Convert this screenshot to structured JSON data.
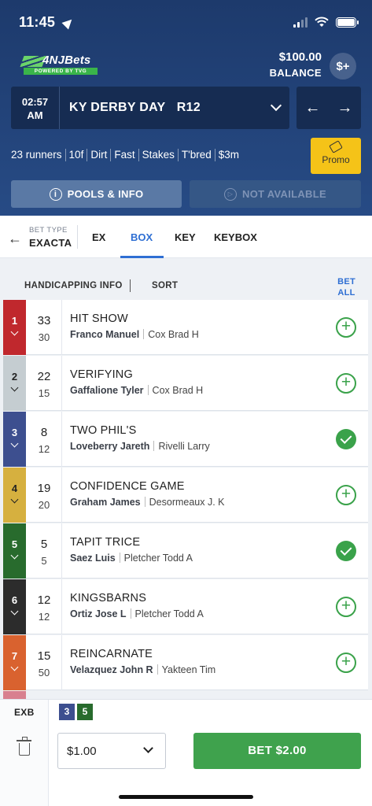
{
  "status_bar": {
    "time": "11:45"
  },
  "brand": {
    "logo_text": "4NJBets",
    "logo_subtitle": "POWERED BY TVG"
  },
  "account": {
    "balance_amount": "$100.00",
    "balance_label": "BALANCE",
    "deposit_icon": "dollar-plus-icon",
    "deposit_label": "$+"
  },
  "race": {
    "post_time": "02:57",
    "post_ampm": "AM",
    "title": "KY DERBY DAY",
    "race_number": "R12",
    "info": [
      "23 runners",
      "10f",
      "Dirt",
      "Fast",
      "Stakes",
      "T'bred",
      "$3m"
    ],
    "prev_arrow": "←",
    "next_arrow": "→"
  },
  "promo": {
    "label": "Promo"
  },
  "buttons": {
    "pools_info": "POOLS & INFO",
    "pools_info_icon": "i",
    "not_available": "NOT AVAILABLE",
    "not_available_icon": "▷"
  },
  "bet_type": {
    "back_arrow": "←",
    "label": "BET TYPE",
    "value": "EXACTA",
    "tabs": [
      {
        "label": "EX",
        "active": false
      },
      {
        "label": "BOX",
        "active": true
      },
      {
        "label": "KEY",
        "active": false
      },
      {
        "label": "KEYBOX",
        "active": false
      }
    ],
    "accent_color": "#2f6fd3"
  },
  "list_header": {
    "handicapping": "HANDICAPPING INFO",
    "sort": "SORT",
    "bet_all_line1": "BET",
    "bet_all_line2": "ALL"
  },
  "runners": [
    {
      "number": "1",
      "saddle_color": "#c0282d",
      "ml_odds": "33",
      "odds": "30",
      "name": "HIT SHOW",
      "jockey": "Franco Manuel",
      "trainer": "Cox Brad H",
      "selected": false
    },
    {
      "number": "2",
      "saddle_color": "#c5cdd1",
      "saddle_text_color": "#222",
      "ml_odds": "22",
      "odds": "15",
      "name": "VERIFYING",
      "jockey": "Gaffalione Tyler",
      "trainer": "Cox Brad H",
      "selected": false
    },
    {
      "number": "3",
      "saddle_color": "#3d4f8f",
      "ml_odds": "8",
      "odds": "12",
      "name": "TWO PHIL'S",
      "jockey": "Loveberry Jareth",
      "trainer": "Rivelli Larry",
      "selected": true
    },
    {
      "number": "4",
      "saddle_color": "#d6b03f",
      "saddle_text_color": "#222",
      "ml_odds": "19",
      "odds": "20",
      "name": "CONFIDENCE GAME",
      "jockey": "Graham James",
      "trainer": "Desormeaux J. K",
      "selected": false
    },
    {
      "number": "5",
      "saddle_color": "#286b2d",
      "ml_odds": "5",
      "odds": "5",
      "name": "TAPIT TRICE",
      "jockey": "Saez Luis",
      "trainer": "Pletcher Todd A",
      "selected": true
    },
    {
      "number": "6",
      "saddle_color": "#2c2c2c",
      "ml_odds": "12",
      "odds": "12",
      "name": "KINGSBARNS",
      "jockey": "Ortiz Jose L",
      "trainer": "Pletcher Todd A",
      "selected": false
    },
    {
      "number": "7",
      "saddle_color": "#d9622f",
      "ml_odds": "15",
      "odds": "50",
      "name": "REINCARNATE",
      "jockey": "Velazquez John R",
      "trainer": "Yakteen Tim",
      "selected": false
    }
  ],
  "betslip": {
    "bet_code": "EXB",
    "selections": [
      {
        "number": "3",
        "color": "#3d4f8f"
      },
      {
        "number": "5",
        "color": "#286b2d"
      }
    ],
    "amount": "$1.00",
    "bet_button": "BET $2.00",
    "bet_color": "#3fa24d"
  }
}
